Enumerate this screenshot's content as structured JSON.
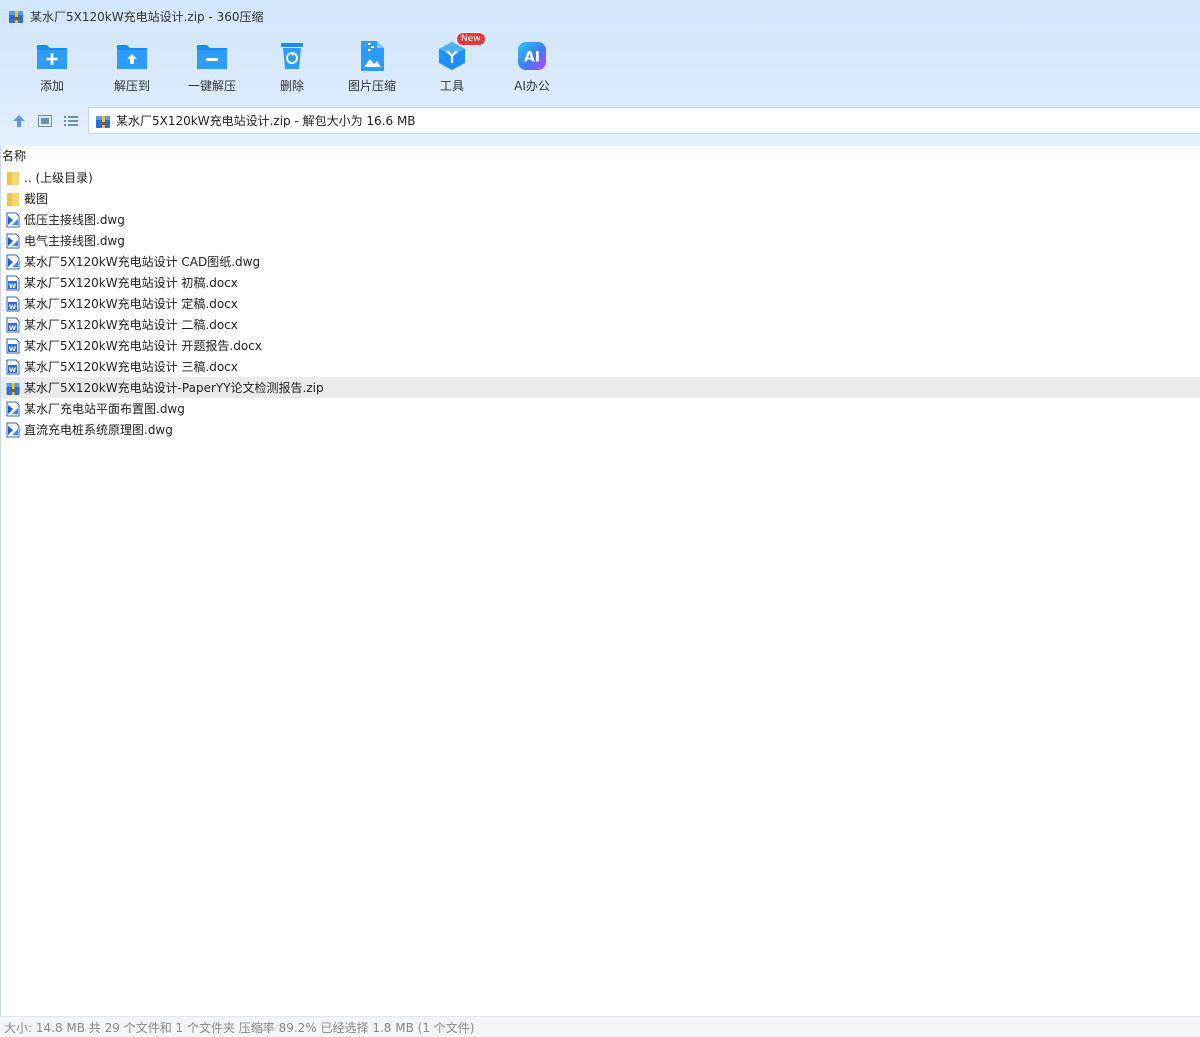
{
  "window": {
    "title": "某水厂5X120kW充电站设计.zip - 360压缩"
  },
  "toolbar": {
    "items": [
      {
        "label": "添加",
        "icon": "add-folder-icon"
      },
      {
        "label": "解压到",
        "icon": "extract-to-icon"
      },
      {
        "label": "一键解压",
        "icon": "one-click-extract-icon"
      },
      {
        "label": "删除",
        "icon": "trash-icon"
      },
      {
        "label": "图片压缩",
        "icon": "image-compress-icon"
      },
      {
        "label": "工具",
        "icon": "tools-cube-icon",
        "badge": "New"
      },
      {
        "label": "AI办公",
        "icon": "ai-office-icon"
      }
    ]
  },
  "address": {
    "text": "某水厂5X120kW充电站设计.zip - 解包大小为 16.6 MB"
  },
  "list": {
    "column_name": "名称",
    "rows": [
      {
        "name": ".. (上级目录)",
        "type": "folder"
      },
      {
        "name": "截图",
        "type": "folder"
      },
      {
        "name": "低压主接线图.dwg",
        "type": "dwg"
      },
      {
        "name": "电气主接线图.dwg",
        "type": "dwg"
      },
      {
        "name": "某水厂5X120kW充电站设计 CAD图纸.dwg",
        "type": "dwg"
      },
      {
        "name": "某水厂5X120kW充电站设计 初稿.docx",
        "type": "docx"
      },
      {
        "name": "某水厂5X120kW充电站设计 定稿.docx",
        "type": "docx"
      },
      {
        "name": "某水厂5X120kW充电站设计 二稿.docx",
        "type": "docx"
      },
      {
        "name": "某水厂5X120kW充电站设计 开题报告.docx",
        "type": "docx"
      },
      {
        "name": "某水厂5X120kW充电站设计 三稿.docx",
        "type": "docx"
      },
      {
        "name": "某水厂5X120kW充电站设计-PaperYY论文检测报告.zip",
        "type": "zip",
        "selected": true
      },
      {
        "name": "某水厂充电站平面布置图.dwg",
        "type": "dwg"
      },
      {
        "name": "直流充电桩系统原理图.dwg",
        "type": "dwg"
      }
    ]
  },
  "status": {
    "text": "大小: 14.8 MB 共 29 个文件和 1 个文件夹 压缩率 89.2% 已经选择 1.8 MB (1 个文件)"
  },
  "colors": {
    "accent": "#1e8fff",
    "header_bg": "#d2e6fc",
    "badge": "#f0343a",
    "selected_row": "#ebebeb"
  }
}
